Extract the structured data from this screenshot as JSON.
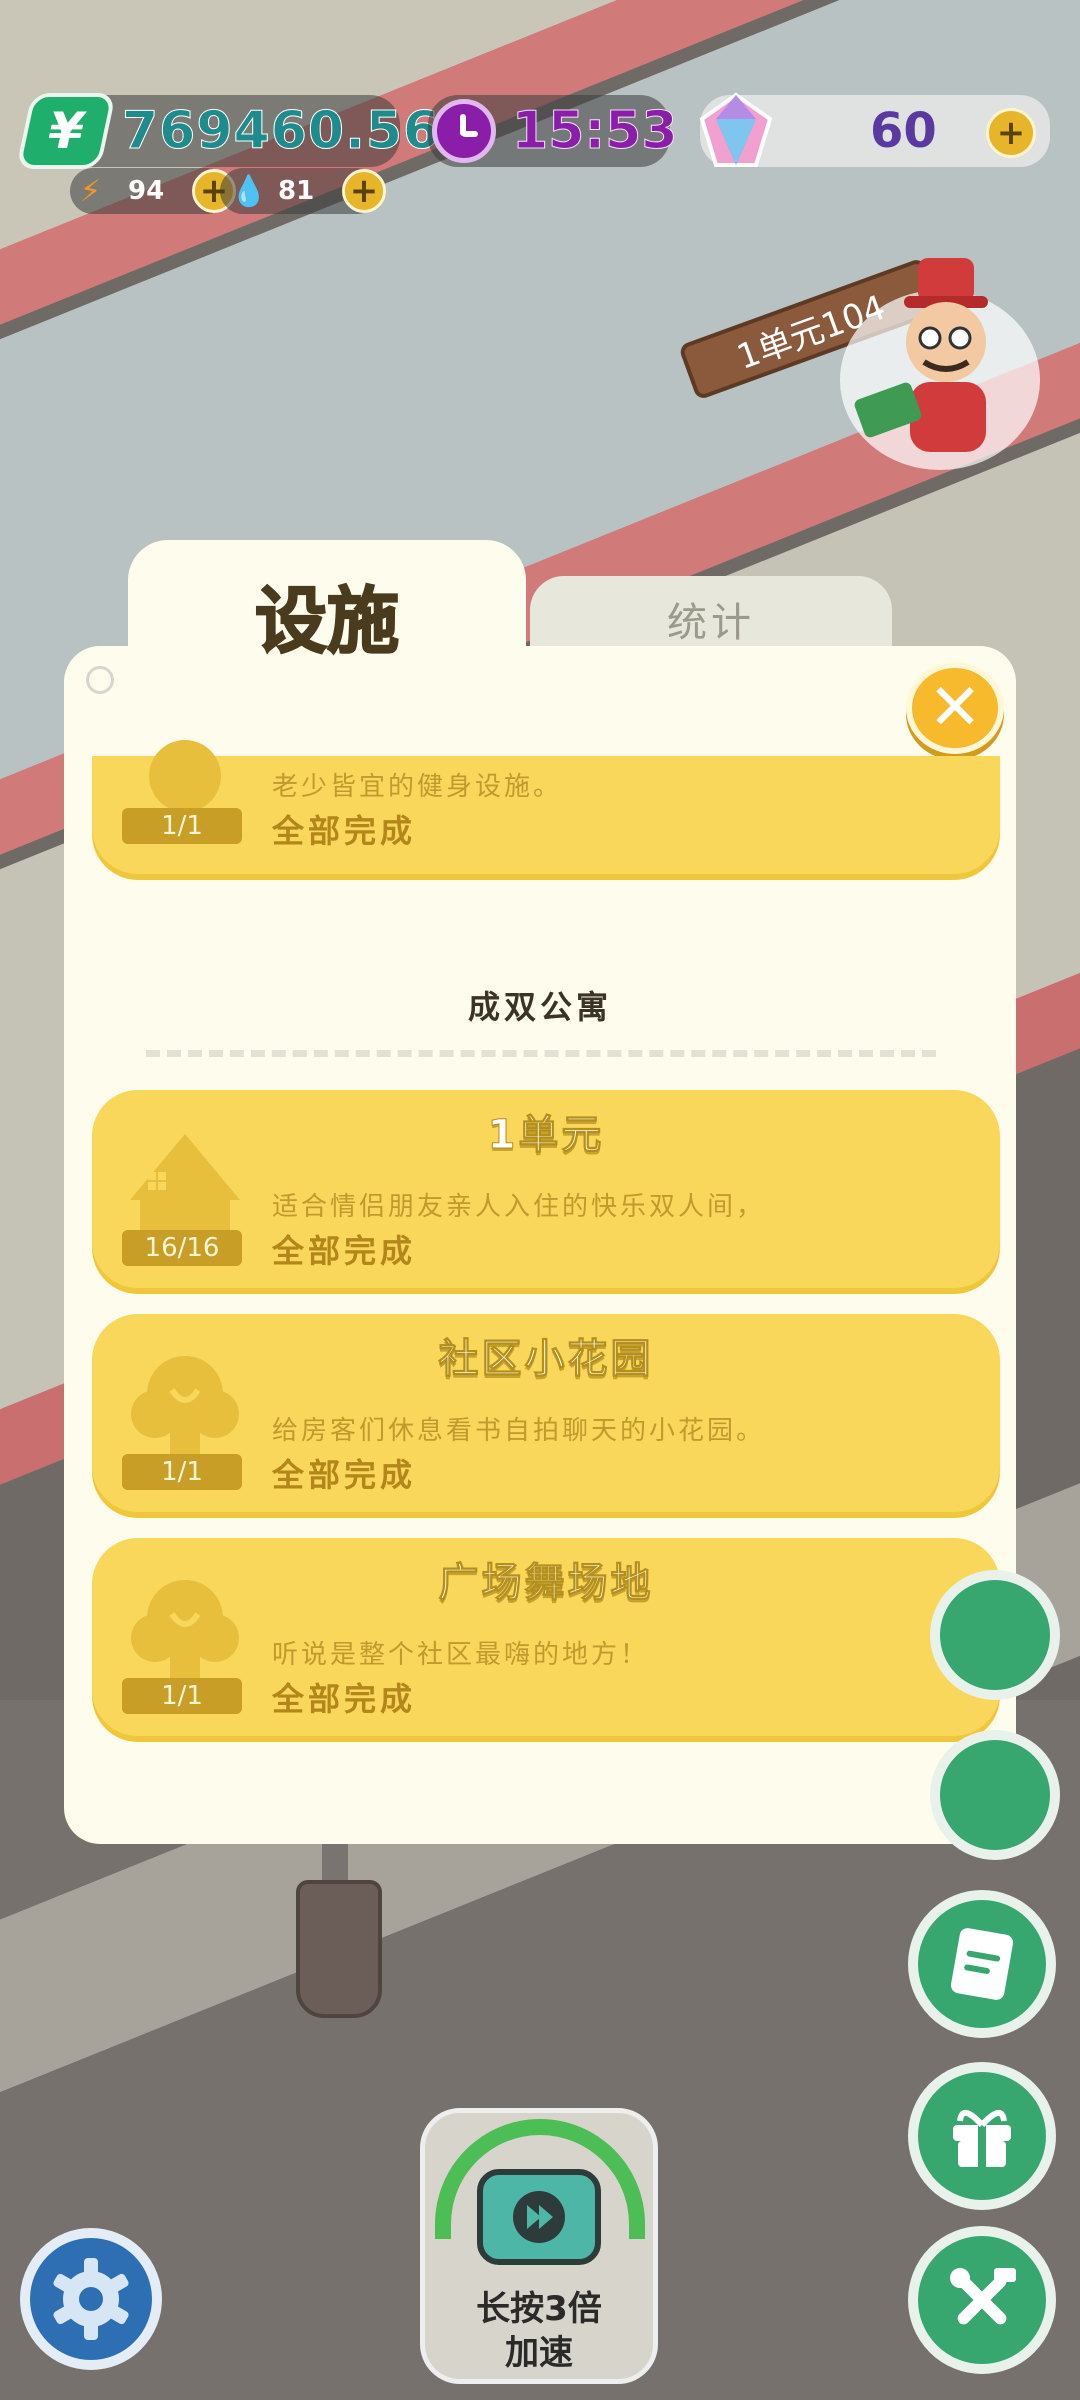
{
  "hud": {
    "money": "769460.56",
    "money_icon": "yen-icon",
    "energy": "94",
    "water": "81",
    "clock": "15:53",
    "gems": "60",
    "plus": "+"
  },
  "sign": {
    "unit": "1单元104"
  },
  "tabs": {
    "active": "设施",
    "inactive": "统计"
  },
  "close_symbol": "✕",
  "cards_top": {
    "desc": "老少皆宜的健身设施。",
    "status": "全部完成",
    "progress": "1/1"
  },
  "group": {
    "title": "成双公寓"
  },
  "cards": [
    {
      "title": "1单元",
      "desc": "适合情侣朋友亲人入住的快乐双人间，",
      "status": "全部完成",
      "progress": "16/16",
      "icon": "house-icon"
    },
    {
      "title": "社区小花园",
      "desc": "给房客们休息看书自拍聊天的小花园。",
      "status": "全部完成",
      "progress": "1/1",
      "icon": "tree-icon"
    },
    {
      "title": "广场舞场地",
      "desc": "听说是整个社区最嗨的地方！",
      "status": "全部完成",
      "progress": "1/1",
      "icon": "tree-icon"
    }
  ],
  "speed": {
    "label_line1": "长按3倍",
    "label_line2": "加速"
  },
  "colors": {
    "panel": "#fefded",
    "card": "#f9d75a",
    "accent_orange": "#f6ba2c",
    "money_green": "#1fae6c",
    "clock_purple": "#8a1ea8"
  }
}
